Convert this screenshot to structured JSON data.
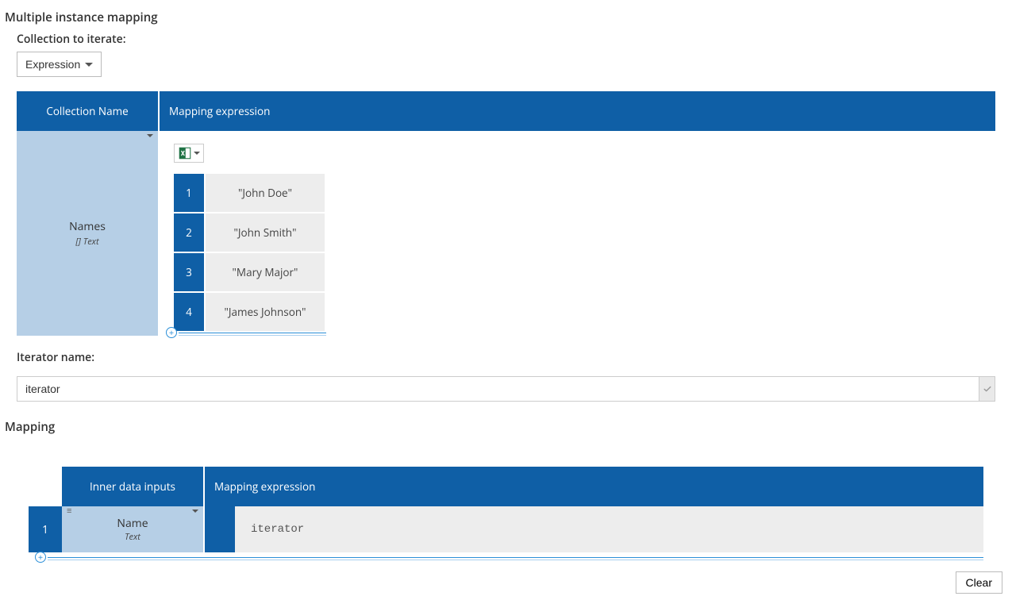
{
  "sections": {
    "multiple_instance_mapping": "Multiple instance mapping",
    "mapping": "Mapping"
  },
  "collection_to_iterate": {
    "label": "Collection to iterate:",
    "dropdown_value": "Expression"
  },
  "collection_table": {
    "headers": {
      "collection_name": "Collection Name",
      "mapping_expression": "Mapping expression"
    },
    "row": {
      "name": "Names",
      "type_prefix": "[]",
      "type": "Text",
      "data": [
        {
          "index": "1",
          "value": "\"John Doe\""
        },
        {
          "index": "2",
          "value": "\"John Smith\""
        },
        {
          "index": "3",
          "value": "\"Mary Major\""
        },
        {
          "index": "4",
          "value": "\"James Johnson\""
        }
      ]
    }
  },
  "iterator": {
    "label": "Iterator name:",
    "value": "iterator"
  },
  "mapping_table": {
    "headers": {
      "inner_inputs": "Inner data inputs",
      "mapping_expression": "Mapping expression"
    },
    "rows": [
      {
        "index": "1",
        "name": "Name",
        "type": "Text",
        "expression": "iterator"
      }
    ]
  },
  "buttons": {
    "clear": "Clear"
  }
}
